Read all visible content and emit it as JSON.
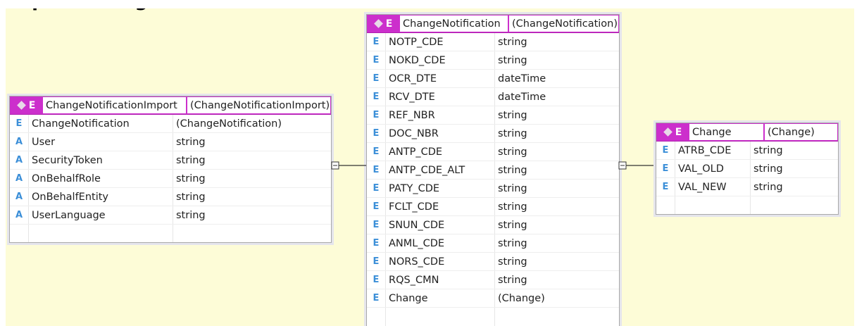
{
  "title": "Import ChangeNotification",
  "entities": {
    "import": {
      "name": "ChangeNotificationImport",
      "type": "(ChangeNotificationImport)",
      "kind": "E",
      "rows": [
        {
          "kind": "E",
          "name": "ChangeNotification",
          "type": "(ChangeNotification)"
        },
        {
          "kind": "A",
          "name": "User",
          "type": "string"
        },
        {
          "kind": "A",
          "name": "SecurityToken",
          "type": "string"
        },
        {
          "kind": "A",
          "name": "OnBehalfRole",
          "type": "string"
        },
        {
          "kind": "A",
          "name": "OnBehalfEntity",
          "type": "string"
        },
        {
          "kind": "A",
          "name": "UserLanguage",
          "type": "string"
        }
      ]
    },
    "notification": {
      "name": "ChangeNotification",
      "type": "(ChangeNotification)",
      "kind": "E",
      "rows": [
        {
          "kind": "E",
          "name": "NOTP_CDE",
          "type": "string"
        },
        {
          "kind": "E",
          "name": "NOKD_CDE",
          "type": "string"
        },
        {
          "kind": "E",
          "name": "OCR_DTE",
          "type": "dateTime"
        },
        {
          "kind": "E",
          "name": "RCV_DTE",
          "type": "dateTime"
        },
        {
          "kind": "E",
          "name": "REF_NBR",
          "type": "string"
        },
        {
          "kind": "E",
          "name": "DOC_NBR",
          "type": "string"
        },
        {
          "kind": "E",
          "name": "ANTP_CDE",
          "type": "string"
        },
        {
          "kind": "E",
          "name": "ANTP_CDE_ALT",
          "type": "string"
        },
        {
          "kind": "E",
          "name": "PATY_CDE",
          "type": "string"
        },
        {
          "kind": "E",
          "name": "FCLT_CDE",
          "type": "string"
        },
        {
          "kind": "E",
          "name": "SNUN_CDE",
          "type": "string"
        },
        {
          "kind": "E",
          "name": "ANML_CDE",
          "type": "string"
        },
        {
          "kind": "E",
          "name": "NORS_CDE",
          "type": "string"
        },
        {
          "kind": "E",
          "name": "RQS_CMN",
          "type": "string"
        },
        {
          "kind": "E",
          "name": "Change",
          "type": "(Change)"
        }
      ]
    },
    "change": {
      "name": "Change",
      "type": "(Change)",
      "kind": "E",
      "rows": [
        {
          "kind": "E",
          "name": "ATRB_CDE",
          "type": "string"
        },
        {
          "kind": "E",
          "name": "VAL_OLD",
          "type": "string"
        },
        {
          "kind": "E",
          "name": "VAL_NEW",
          "type": "string"
        }
      ]
    }
  },
  "colors": {
    "header": "#cc2fcc",
    "background": "#fdfcd7",
    "icon": "#3c8fd8"
  }
}
